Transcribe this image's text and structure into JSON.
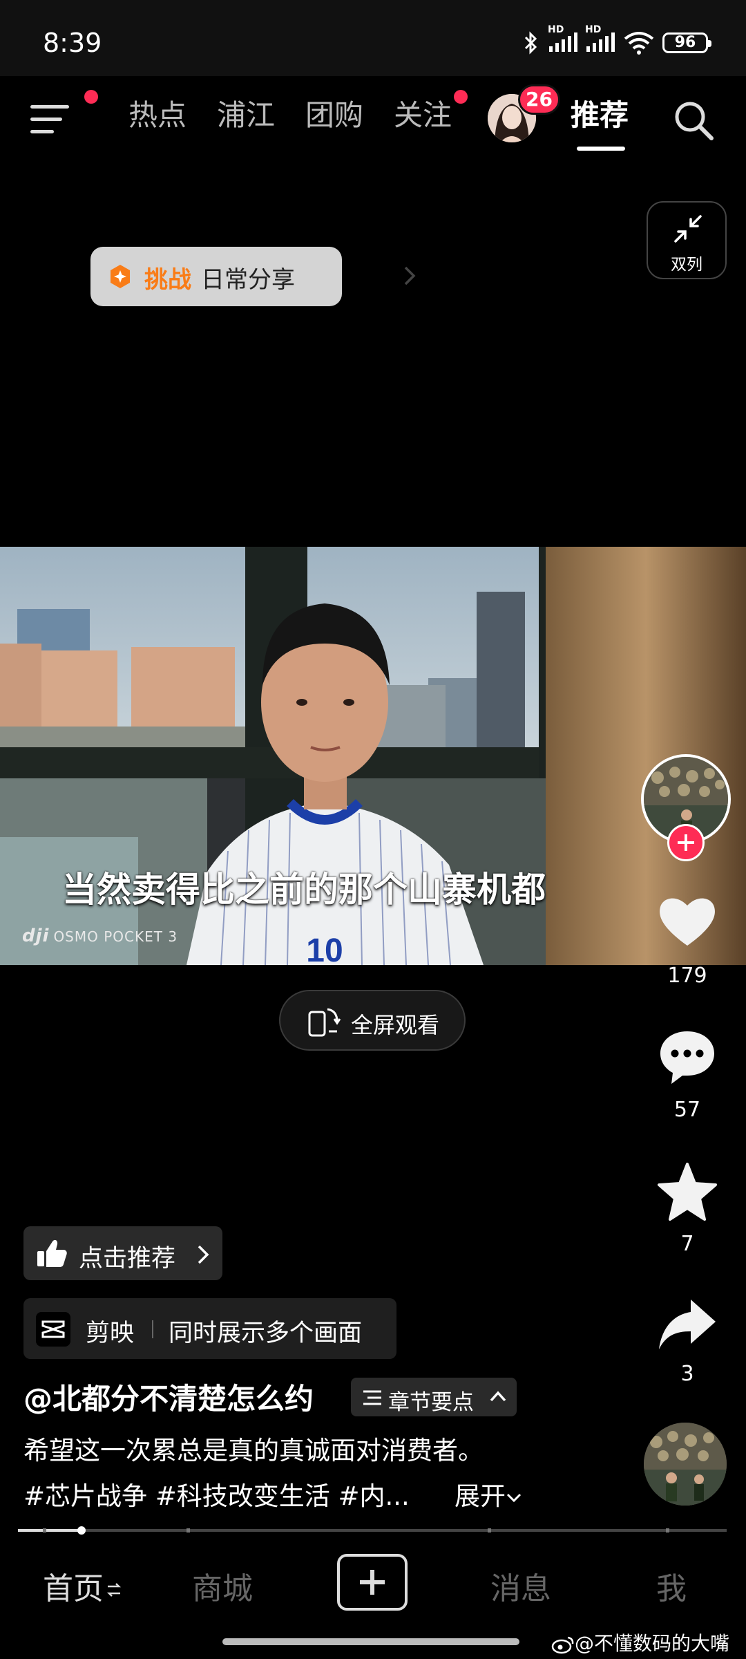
{
  "status_bar": {
    "time": "8:39",
    "battery": "96",
    "network_label": "HD"
  },
  "top_nav": {
    "tabs": [
      {
        "label": "热点",
        "active": false
      },
      {
        "label": "浦江",
        "active": false
      },
      {
        "label": "团购",
        "active": false
      },
      {
        "label": "关注",
        "active": false,
        "dot": true
      },
      {
        "label": "推荐",
        "active": true
      }
    ],
    "avatar_badge": "26",
    "menu_has_dot": true
  },
  "dual_column": {
    "label": "双列"
  },
  "challenge": {
    "tag": "挑战",
    "text": "日常分享"
  },
  "video": {
    "caption": "当然卖得比之前的那个山寨机都",
    "watermark_brand": "dji",
    "watermark_model": "OSMO POCKET 3"
  },
  "fullscreen": {
    "label": "全屏观看"
  },
  "actions": {
    "likes": "179",
    "comments": "57",
    "favorites": "7",
    "shares": "3"
  },
  "recommend": {
    "label": "点击推荐"
  },
  "capcut": {
    "name": "剪映",
    "desc": "同时展示多个画面"
  },
  "post": {
    "author": "@北都分不清楚怎么约",
    "chapter_label": "章节要点",
    "desc_line1": "希望这一次累总是真的真诚面对消费者。",
    "desc_line2": "#芯片战争 #科技改变生活 #内...",
    "expand": "展开"
  },
  "progress": {
    "fraction": 0.09
  },
  "bottom_nav": {
    "items": [
      {
        "label": "首页",
        "active": true
      },
      {
        "label": "商城",
        "active": false
      },
      {
        "label": "消息",
        "active": false
      },
      {
        "label": "我",
        "active": false
      }
    ]
  },
  "overlay": {
    "weibo_watermark": "@不懂数码的大嘴"
  },
  "colors": {
    "accent_red": "#fe2c55",
    "challenge_orange": "#f97c17",
    "background": "#000000"
  }
}
